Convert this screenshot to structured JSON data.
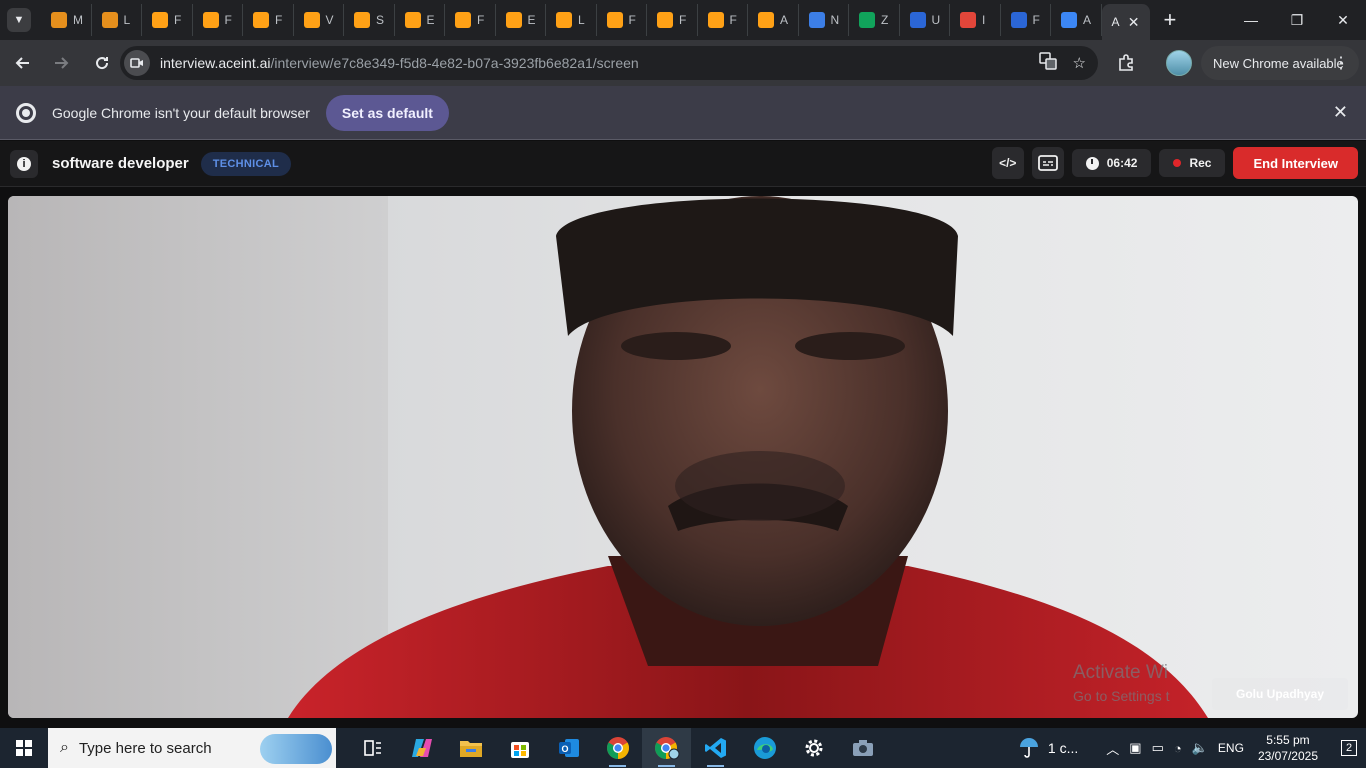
{
  "browser": {
    "tabs": [
      {
        "label": "M",
        "icon": "amazon-icon",
        "color": "#e58f1d"
      },
      {
        "label": "L",
        "icon": "amazon-icon",
        "color": "#e58f1d"
      },
      {
        "label": "F",
        "icon": "leetcode-icon",
        "color": "#ffa116"
      },
      {
        "label": "F",
        "icon": "leetcode-icon",
        "color": "#ffa116"
      },
      {
        "label": "F",
        "icon": "leetcode-icon",
        "color": "#ffa116"
      },
      {
        "label": "V",
        "icon": "leetcode-icon",
        "color": "#ffa116"
      },
      {
        "label": "S",
        "icon": "leetcode-icon",
        "color": "#ffa116"
      },
      {
        "label": "E",
        "icon": "leetcode-icon",
        "color": "#ffa116"
      },
      {
        "label": "F",
        "icon": "leetcode-icon",
        "color": "#ffa116"
      },
      {
        "label": "E",
        "icon": "leetcode-icon",
        "color": "#ffa116"
      },
      {
        "label": "L",
        "icon": "leetcode-icon",
        "color": "#ffa116"
      },
      {
        "label": "F",
        "icon": "leetcode-icon",
        "color": "#ffa116"
      },
      {
        "label": "F",
        "icon": "leetcode-icon",
        "color": "#ffa116"
      },
      {
        "label": "F",
        "icon": "leetcode-icon",
        "color": "#ffa116"
      },
      {
        "label": "A",
        "icon": "leetcode-icon",
        "color": "#ffa116"
      },
      {
        "label": "N",
        "icon": "ms-icon",
        "color": "#3c7ee6"
      },
      {
        "label": "Z",
        "icon": "z-icon",
        "color": "#11a35b"
      },
      {
        "label": "U",
        "icon": "unstop-icon",
        "color": "#2b66d6"
      },
      {
        "label": "I",
        "icon": "gmail-icon",
        "color": "#e2463a"
      },
      {
        "label": "F",
        "icon": "unstop-icon",
        "color": "#2b66d6"
      },
      {
        "label": "A",
        "icon": "aceint-icon",
        "color": "#3c87f5"
      }
    ],
    "active_tab": {
      "label": "A",
      "close": "✕"
    },
    "new_tab": "+",
    "window": {
      "minimize": "—",
      "restore": "❐",
      "close": "✕"
    },
    "url_host": "interview.aceint.ai",
    "url_path": "/interview/e7c8e349-f5d8-4e82-b07a-3923fb6e82a1/screen",
    "update_label": "New Chrome available"
  },
  "infobar": {
    "message": "Google Chrome isn't your default browser",
    "button": "Set as default"
  },
  "app": {
    "role_title": "software developer",
    "badge": "TECHNICAL",
    "code_icon_label": "</>",
    "timer": "06:42",
    "rec_label": "Rec",
    "end_button": "End Interview",
    "participant_name": "Golu Upadhyay",
    "colors": {
      "end": "#d92b2b",
      "badge_text": "#5e8fe6",
      "rec_dot": "#e0262a"
    }
  },
  "watermark": {
    "line1": "Activate Wi",
    "line2": "Go to Settings t"
  },
  "taskbar": {
    "search_placeholder": "Type here to search",
    "apps": [
      "task-view-icon",
      "copilot-icon",
      "file-explorer-icon",
      "store-icon",
      "outlook-icon",
      "chrome-icon",
      "chrome-profile-icon",
      "vscode-icon",
      "edge-icon",
      "settings-icon",
      "camera-icon"
    ],
    "weather": "1 c...",
    "lang": "ENG",
    "time": "5:55 pm",
    "date": "23/07/2025",
    "notifications": "2"
  }
}
